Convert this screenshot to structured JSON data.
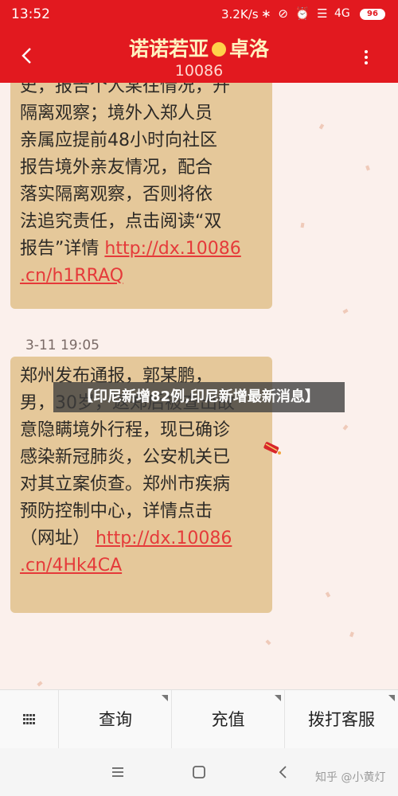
{
  "status_bar": {
    "time": "13:52",
    "network_speed": "3.2K/s",
    "icons": "∗ ⊘ ⏰ ☰",
    "signal": "4G",
    "battery": "96"
  },
  "header": {
    "sender_name_left": "诺诺若亚",
    "sender_name_right": "卓洛",
    "number": "10086",
    "back_icon": "chevron-left-icon",
    "more_icon": "more-vertical-icon"
  },
  "messages": [
    {
      "lines": [
        "史，报告个人某往情况，开",
        "隔离观察；境外入郑人员",
        "亲属应提前48小时向社区",
        "报告境外亲友情况，配合",
        "落实隔离观察，否则将依",
        "法追究责任，点击阅读“双"
      ],
      "tail_text": "报告”详情 ",
      "link_part1": "http://dx.10086",
      "link_part2": ".cn/h1RRAQ"
    },
    {
      "timestamp": "3-11 19:05",
      "lines": [
        "郑州发布通报，郭某鹏，",
        "男，30岁，返郑后被查出故",
        "意隐瞒境外行程，现已确诊",
        "感染新冠肺炎，公安机关已",
        "对其立案侦查。郑州市疾病",
        "预防控制中心，详情点击"
      ],
      "tail_text": "（网址） ",
      "link_part1": "http://dx.10086",
      "link_part2": ".cn/4Hk4CA"
    }
  ],
  "banner": {
    "text": "【印尼新增82例,印尼新增最新消息】"
  },
  "bottom_menu": {
    "keyboard_icon": "keyboard-icon",
    "items": [
      "查询",
      "充值",
      "拨打客服"
    ]
  },
  "navbar": {
    "menu_icon": "menu-icon",
    "home_icon": "home-square-icon",
    "back_icon": "back-triangle-icon"
  },
  "watermark": "知乎 @小黄灯",
  "colors": {
    "header_red": "#e2191f",
    "bubble": "#e5c89a",
    "link": "#e53a3a",
    "background": "#fbf0ec"
  }
}
